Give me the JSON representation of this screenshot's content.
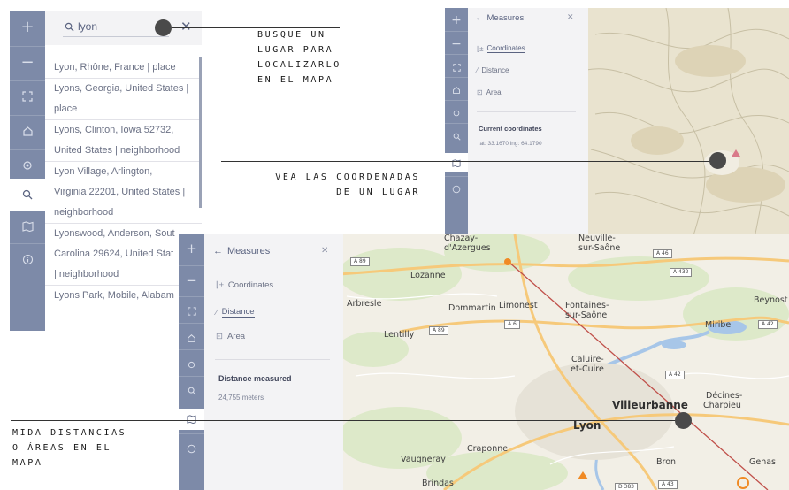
{
  "search_panel": {
    "query": "lyon",
    "results": [
      [
        "Lyon, Rhône, France | place"
      ],
      [
        "Lyons, Georgia, United States |",
        "place"
      ],
      [
        "Lyons, Clinton, Iowa 52732,",
        "United States | neighborhood"
      ],
      [
        "Lyon Village, Arlington,",
        "Virginia 22201, United States |",
        "neighborhood"
      ],
      [
        "Lyonswood, Anderson, Sout",
        "Carolina 29624, United Stat",
        "| neighborhood"
      ],
      [
        "Lyons Park, Mobile, Alabam"
      ]
    ]
  },
  "toolbar": {
    "zoom_in": "+",
    "zoom_out": "−",
    "icons": [
      "zoom-in-icon",
      "zoom-out-icon",
      "fullscreen-icon",
      "home-icon",
      "locate-icon",
      "search-icon",
      "map-icon",
      "info-icon"
    ]
  },
  "coords_panel": {
    "back_arrow": "←",
    "title": "Measures",
    "close": "✕",
    "items": [
      "Coordinates",
      "Distance",
      "Area"
    ],
    "section_title": "Current coordinates",
    "value": "lat: 33.1670 lng: 64.1790"
  },
  "distance_panel": {
    "back_arrow": "←",
    "title": "Measures",
    "close": "✕",
    "items": [
      "Coordinates",
      "Distance",
      "Area"
    ],
    "section_title": "Distance measured",
    "value": "24,755 meters"
  },
  "annotations": {
    "search": [
      "Busque un",
      "lugar para",
      "localizarlo",
      "en el mapa"
    ],
    "coords": [
      "Vea las coordenadas",
      "de un lugar"
    ],
    "distance": [
      "Mida distancias",
      "o áreas en el",
      "mapa"
    ]
  },
  "map_labels": {
    "places": [
      "Chazay-",
      "d'Azergues",
      "Neuville-",
      "sur-Saône",
      "Lozanne",
      "Beynost",
      "Arbresle",
      "Dommartin",
      "Limonest",
      "Fontaines-",
      "sur-Saône",
      "Miribel",
      "Lentilly",
      "Caluire-",
      "et-Cuire",
      "Villeurbanne",
      "Décines-",
      "Charpieu",
      "Lyon",
      "Craponne",
      "Vaugneray",
      "Bron",
      "Genas",
      "Brindas"
    ],
    "roads": [
      "A 89",
      "A 46",
      "A 432",
      "A 89",
      "A 6",
      "A 42",
      "A 42",
      "A 43",
      "D 383"
    ]
  },
  "colors": {
    "toolbar": "#7d8aa8",
    "panel": "#f3f3f5",
    "measure_line": "#c0504a",
    "marker": "#f08a24"
  }
}
